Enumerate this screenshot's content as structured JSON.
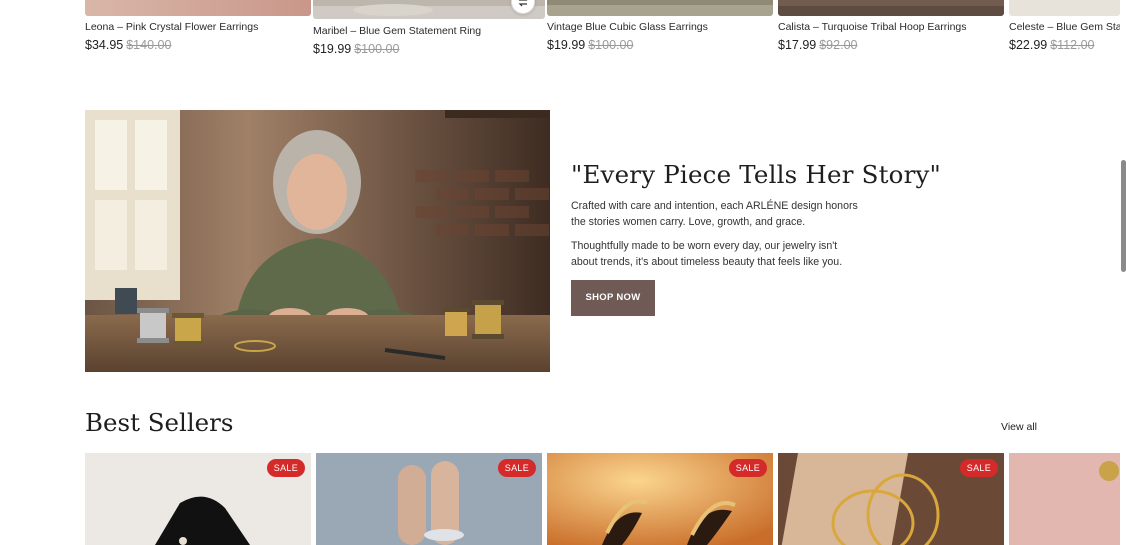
{
  "top_products": [
    {
      "title": "Leona – Pink Crystal Flower Earrings",
      "sale_price": "$34.95",
      "original_price": "$140.00"
    },
    {
      "title": "Maribel – Blue Gem Statement Ring",
      "sale_price": "$19.99",
      "original_price": "$100.00"
    },
    {
      "title": "Vintage Blue Cubic Glass Earrings",
      "sale_price": "$19.99",
      "original_price": "$100.00"
    },
    {
      "title": "Calista – Turquoise Tribal Hoop Earrings",
      "sale_price": "$17.99",
      "original_price": "$92.00"
    },
    {
      "title": "Celeste – Blue Gem Statem",
      "sale_price": "$22.99",
      "original_price": "$112.00"
    }
  ],
  "story": {
    "heading": "\"Every Piece Tells Her Story\"",
    "paragraph_1": "Crafted with care and intention, each ARLÉNE design honors the stories women carry. Love, growth, and grace.",
    "paragraph_2": "Thoughtfully made to be worn every day, our jewelry isn't about trends, it's about timeless beauty that feels like you.",
    "button_label": "SHOP NOW"
  },
  "best_sellers": {
    "title": "Best Sellers",
    "view_all_label": "View all",
    "badges": [
      "SALE",
      "SALE",
      "SALE",
      "SALE"
    ]
  },
  "colors": {
    "button_bg": "#6f5a55",
    "sale_badge": "#d42a2a",
    "strike_price": "#9a9a9a"
  }
}
